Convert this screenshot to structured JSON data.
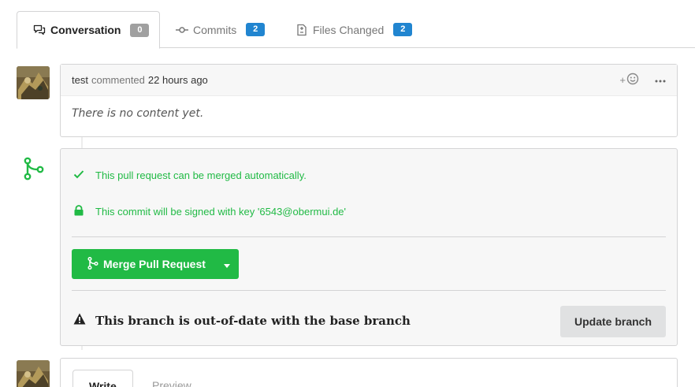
{
  "tabs": [
    {
      "label": "Conversation",
      "count": "0",
      "icon": "comment-discussion-icon"
    },
    {
      "label": "Commits",
      "count": "2",
      "icon": "git-commit-icon"
    },
    {
      "label": "Files Changed",
      "count": "2",
      "icon": "diff-icon"
    }
  ],
  "comment": {
    "author": "test",
    "action": "commented",
    "time": "22 hours ago",
    "react_plus": "+",
    "body": "There is no content yet."
  },
  "merge": {
    "check_text": "This pull request can be merged automatically.",
    "sign_text": "This commit will be signed with key '6543@obermui.de'",
    "merge_button": "Merge Pull Request",
    "outdated_text": "This branch is out-of-date with the base branch",
    "update_button": "Update branch"
  },
  "reply": {
    "write_tab": "Write",
    "preview_tab": "Preview"
  },
  "colors": {
    "success": "#21ba45",
    "badge_blue": "#2185d0",
    "badge_grey": "#a0a0a0"
  }
}
